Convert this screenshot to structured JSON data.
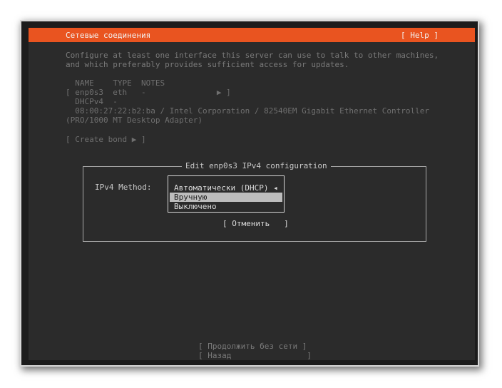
{
  "header": {
    "title": "Сетевые соединения",
    "help": "[ Help ]"
  },
  "intro": [
    "Configure at least one interface this server can use to talk to other machines,",
    "and which preferably provides sufficient access for updates."
  ],
  "table": {
    "header": "  NAME    TYPE  NOTES",
    "row": "[ enp0s3  eth   -               ▶ ]",
    "dhcp": "  DHCPv4  -",
    "mac": "  08:00:27:22:b2:ba / Intel Corporation / 82540EM Gigabit Ethernet Controller",
    "mac2": "(PRO/1000 MT Desktop Adapter)"
  },
  "create_bond": "[ Create bond ▶ ]",
  "dialog": {
    "title": "Edit enp0s3 IPv4 configuration",
    "method_label": "IPv4 Method:",
    "options": [
      "Автоматически (DHCP) ◂",
      "Вручную",
      "Выключено"
    ],
    "selected": "Вручную",
    "cancel": "[ Отменить   ]"
  },
  "footer": {
    "continue": "[ Продолжить без сети ]",
    "back": "[ Назад                ]"
  }
}
